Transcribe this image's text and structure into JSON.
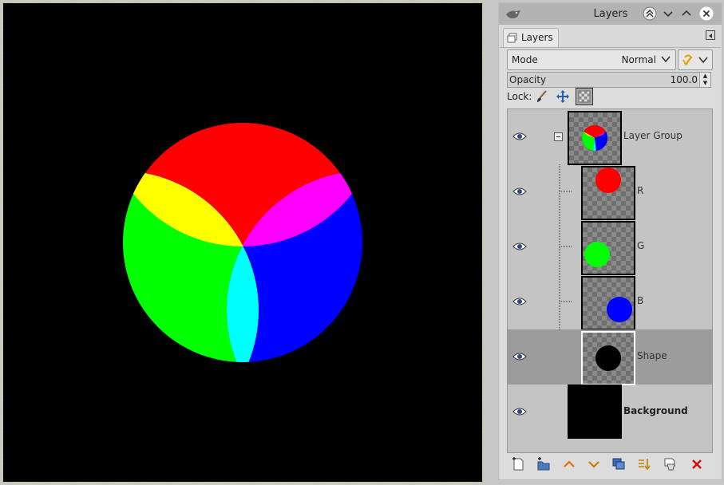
{
  "window": {
    "title": "Layers"
  },
  "tab": {
    "label": "Layers"
  },
  "mode": {
    "label": "Mode",
    "value": "Normal"
  },
  "opacity": {
    "label": "Opacity",
    "value": "100.0",
    "level": 1.0
  },
  "lock": {
    "label": "Lock:"
  },
  "layers": [
    {
      "name": "Layer Group",
      "type": "group",
      "visible": true
    },
    {
      "name": "R",
      "type": "layer",
      "visible": true,
      "color": "#ff0000"
    },
    {
      "name": "G",
      "type": "layer",
      "visible": true,
      "color": "#00ff00"
    },
    {
      "name": "B",
      "type": "layer",
      "visible": true,
      "color": "#0000ff"
    },
    {
      "name": "Shape",
      "type": "layer",
      "visible": true,
      "selected": true,
      "color": "#000000"
    },
    {
      "name": "Background",
      "type": "layer",
      "visible": true,
      "color": "#000000"
    }
  ],
  "colors": {
    "red": "#ff0000",
    "green": "#00ff00",
    "blue": "#0000ff",
    "yellow": "#ffff00",
    "magenta": "#ff00ff",
    "cyan": "#00ffff"
  }
}
